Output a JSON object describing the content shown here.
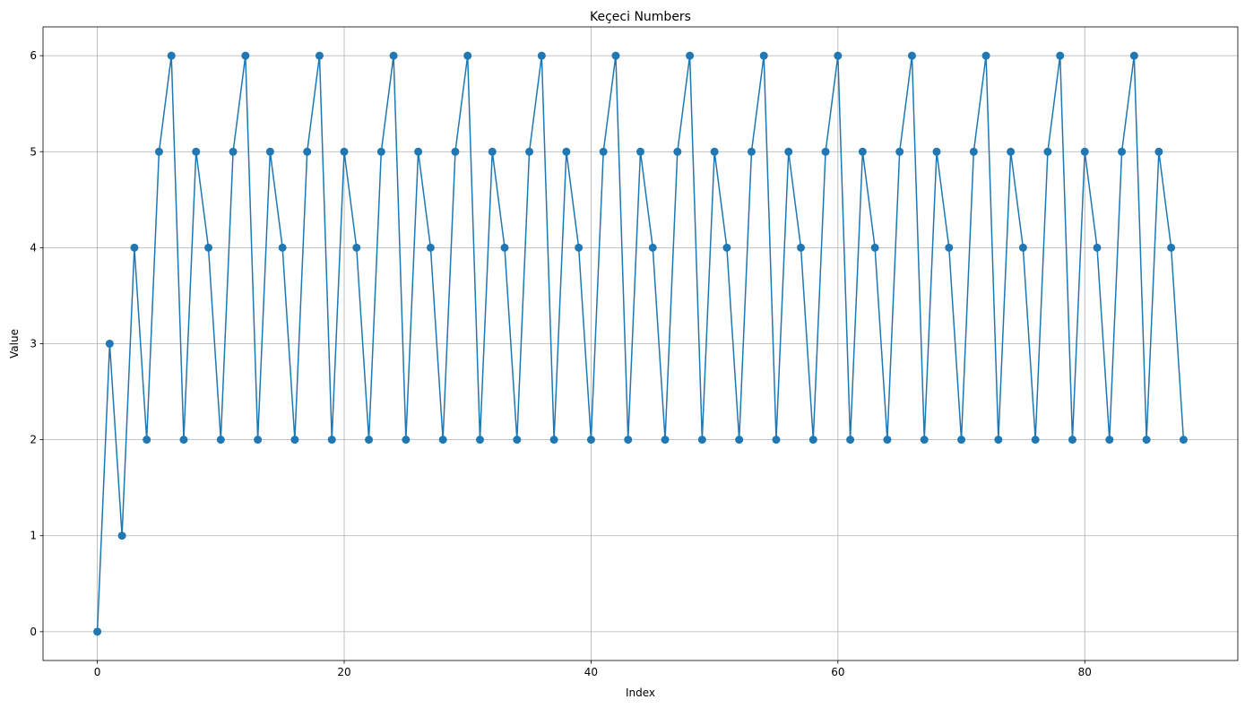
{
  "chart_data": {
    "type": "line",
    "title": "Keçeci Numbers",
    "xlabel": "Index",
    "ylabel": "Value",
    "xlim": [
      -4.4,
      92.4
    ],
    "ylim": [
      -0.3,
      6.3
    ],
    "xticks": [
      0,
      20,
      40,
      60,
      80
    ],
    "yticks": [
      0,
      1,
      2,
      3,
      4,
      5,
      6
    ],
    "grid": true,
    "marker": "circle",
    "color": "#1f77b4",
    "series": [
      {
        "values": [
          0,
          3,
          1,
          4,
          2,
          5,
          6,
          2,
          5,
          4,
          2,
          5,
          6,
          2,
          5,
          4,
          2,
          5,
          6,
          2,
          5,
          4,
          2,
          5,
          6,
          2,
          5,
          4,
          2,
          5,
          6,
          2,
          5,
          4,
          2,
          5,
          6,
          2,
          5,
          4,
          2,
          5,
          6,
          2,
          5,
          4,
          2,
          5,
          6,
          2,
          5,
          4,
          2,
          5,
          6,
          2,
          5,
          4,
          2,
          5,
          6,
          2,
          5,
          4,
          2,
          5,
          6,
          2,
          5,
          4,
          2,
          5,
          6,
          2,
          5,
          4,
          2,
          5,
          6,
          2,
          5,
          4,
          2,
          5,
          6,
          2,
          5,
          4,
          2
        ]
      }
    ]
  }
}
